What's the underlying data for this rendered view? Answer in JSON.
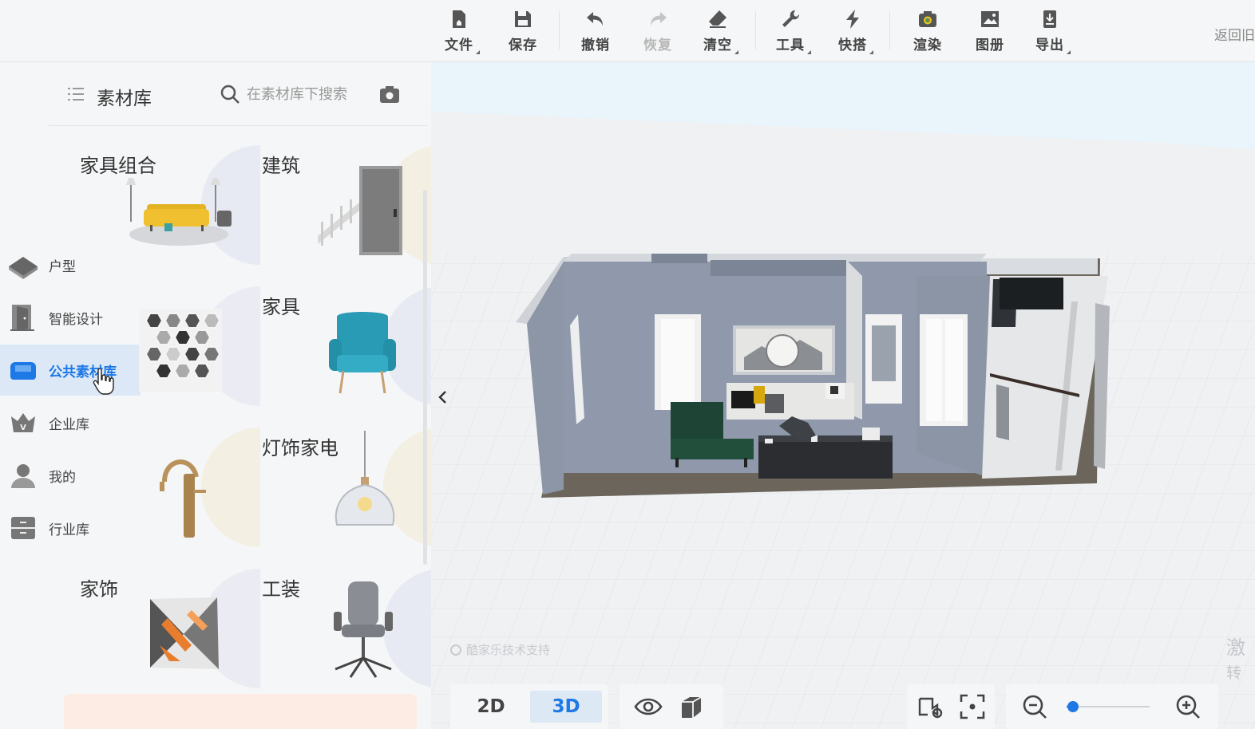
{
  "toolbar": {
    "items": [
      {
        "label": "文件",
        "icon": "file-icon"
      },
      {
        "label": "保存",
        "icon": "save-icon"
      },
      {
        "label": "撤销",
        "icon": "undo-icon"
      },
      {
        "label": "恢复",
        "icon": "redo-icon",
        "disabled": true
      },
      {
        "label": "清空",
        "icon": "eraser-icon"
      },
      {
        "label": "工具",
        "icon": "wrench-icon"
      },
      {
        "label": "快搭",
        "icon": "lightning-icon"
      },
      {
        "label": "渲染",
        "icon": "camera-render-icon"
      },
      {
        "label": "图册",
        "icon": "album-icon"
      },
      {
        "label": "导出",
        "icon": "export-icon"
      }
    ],
    "back_label": "返回旧"
  },
  "left_nav": {
    "items": [
      {
        "label": "户型",
        "icon": "floorplan-icon"
      },
      {
        "label": "智能设计",
        "icon": "smart-design-icon"
      },
      {
        "label": "公共素材库",
        "icon": "public-library-icon",
        "active": true
      },
      {
        "label": "企业库",
        "icon": "enterprise-icon"
      },
      {
        "label": "我的",
        "icon": "user-icon"
      },
      {
        "label": "行业库",
        "icon": "industry-icon"
      }
    ]
  },
  "panel": {
    "title": "素材库",
    "search_placeholder": "在素材库下搜索",
    "categories": [
      {
        "label": "家具组合"
      },
      {
        "label": "建筑"
      },
      {
        "label": ""
      },
      {
        "label": "家具"
      },
      {
        "label": ""
      },
      {
        "label": "灯饰家电"
      },
      {
        "label": "家饰"
      },
      {
        "label": "工装"
      }
    ]
  },
  "viewport": {
    "watermark": "酷家乐技术支持",
    "view_modes": [
      "2D",
      "3D"
    ],
    "active_view": "3D",
    "zoom_level": 0.08,
    "side_note": [
      "激",
      "转"
    ]
  },
  "colors": {
    "accent": "#1e78e6",
    "active_bg": "#dce8f6"
  }
}
